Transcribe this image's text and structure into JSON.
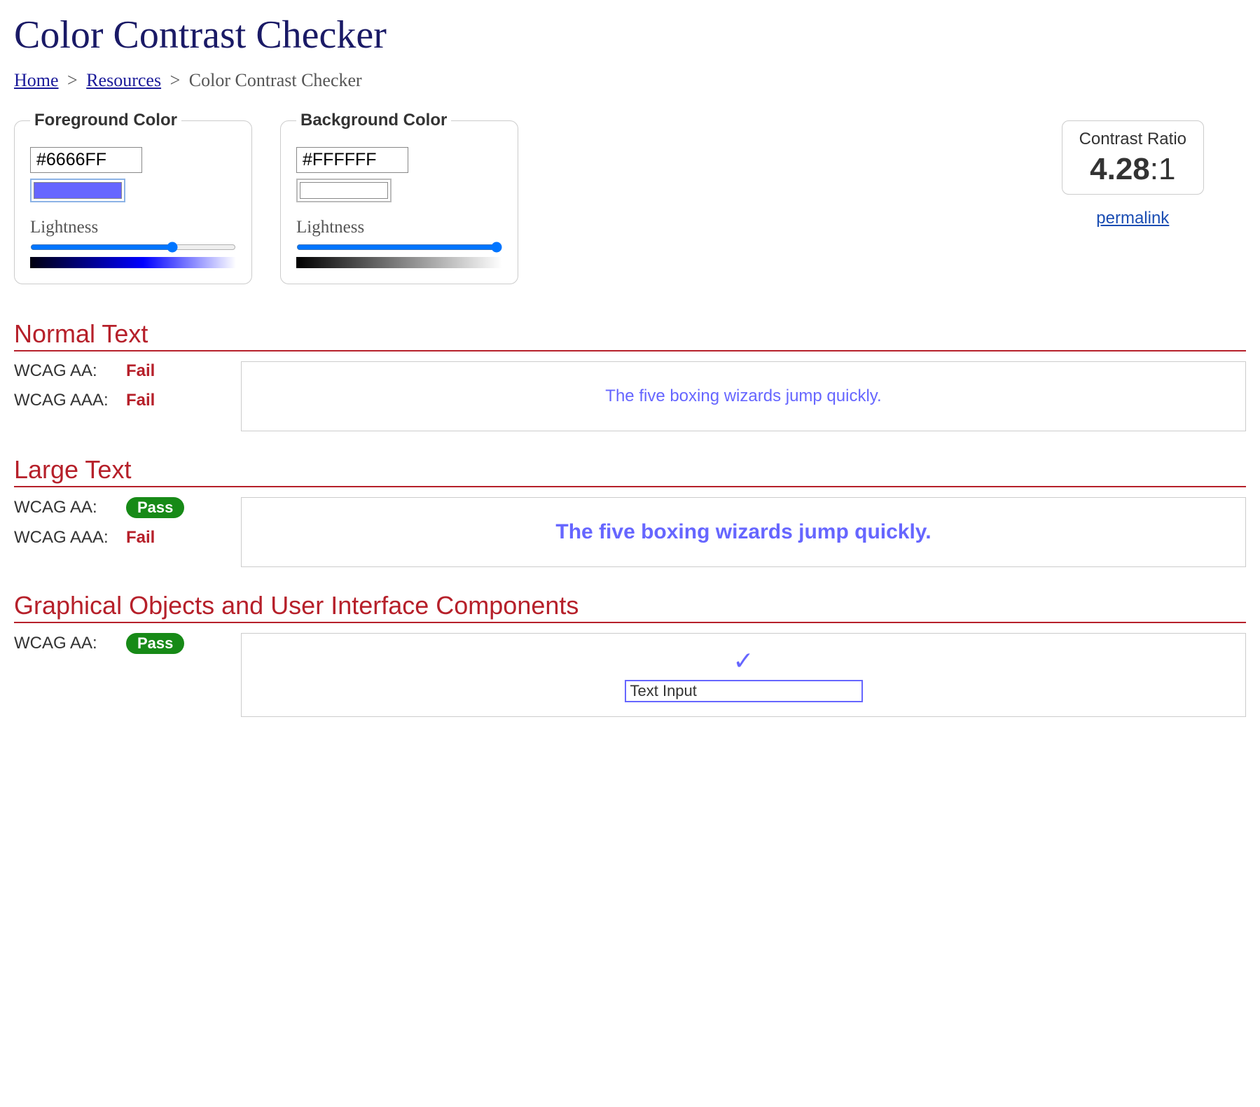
{
  "title": "Color Contrast Checker",
  "breadcrumb": {
    "home": "Home",
    "resources": "Resources",
    "current": "Color Contrast Checker",
    "sep": ">"
  },
  "foreground": {
    "legend": "Foreground Color",
    "hex": "#6666FF",
    "lightness_label": "Lightness",
    "slider_value": 70
  },
  "background": {
    "legend": "Background Color",
    "hex": "#FFFFFF",
    "lightness_label": "Lightness",
    "slider_value": 100
  },
  "ratio": {
    "label": "Contrast Ratio",
    "value": "4.28",
    "suffix": ":1",
    "permalink": "permalink"
  },
  "sections": {
    "normal": {
      "title": "Normal Text",
      "aa_label": "WCAG AA:",
      "aa_result": "Fail",
      "aaa_label": "WCAG AAA:",
      "aaa_result": "Fail",
      "sample": "The five boxing wizards jump quickly."
    },
    "large": {
      "title": "Large Text",
      "aa_label": "WCAG AA:",
      "aa_result": "Pass",
      "aaa_label": "WCAG AAA:",
      "aaa_result": "Fail",
      "sample": "The five boxing wizards jump quickly."
    },
    "ui": {
      "title": "Graphical Objects and User Interface Components",
      "aa_label": "WCAG AA:",
      "aa_result": "Pass",
      "input_value": "Text Input"
    }
  },
  "colors": {
    "fg": "#6666FF",
    "bg": "#FFFFFF"
  }
}
